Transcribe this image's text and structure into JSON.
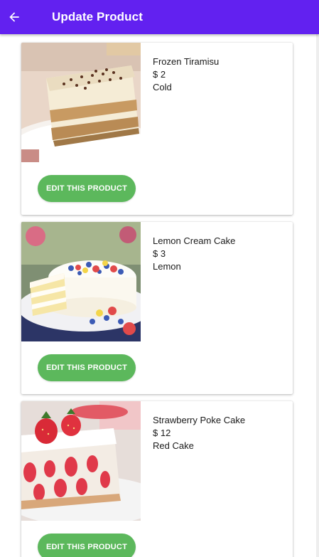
{
  "app_bar": {
    "title": "Update Product",
    "back_icon": "arrow-left-icon",
    "color": "#6221f0"
  },
  "products": [
    {
      "name": "Frozen Tiramisu",
      "price": "$ 2",
      "category": "Cold",
      "button_label": "Edit this product"
    },
    {
      "name": "Lemon Cream Cake",
      "price": "$ 3",
      "category": "Lemon",
      "button_label": "Edit this product"
    },
    {
      "name": "Strawberry Poke Cake",
      "price": "$ 12",
      "category": "Red Cake",
      "button_label": "Edit this product"
    }
  ],
  "colors": {
    "accent": "#6221f0",
    "button": "#5cb85c"
  }
}
